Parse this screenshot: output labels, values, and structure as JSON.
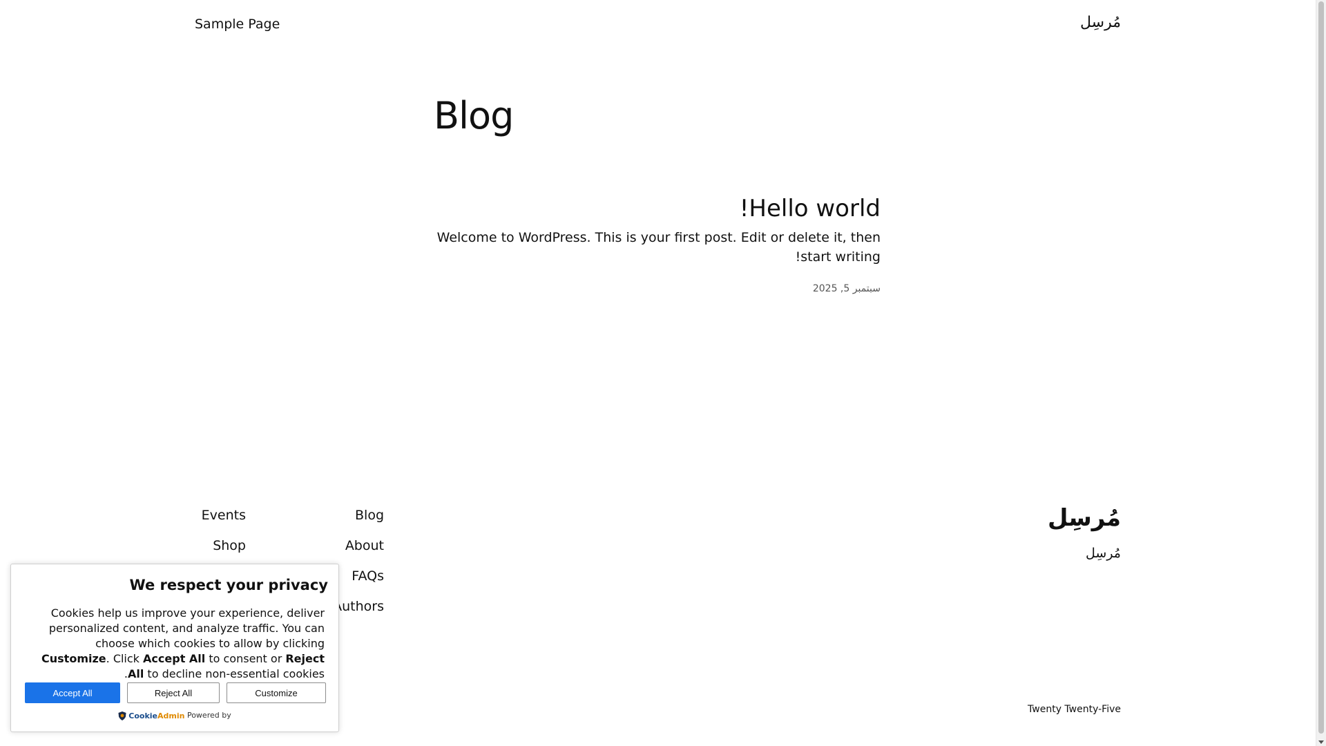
{
  "header": {
    "site_title": "مُرسِل",
    "nav_link": "Sample Page"
  },
  "main": {
    "page_title": "Blog",
    "post": {
      "title": "Hello world!",
      "excerpt": "Welcome to WordPress. This is your first post. Edit or delete it, then start writing!",
      "date": "سبتمبر 5, 2025"
    }
  },
  "footer": {
    "site_title": "مُرسِل",
    "tagline": "مُرسِل",
    "nav_col_1": [
      "Blog",
      "About",
      "FAQs",
      "Authors"
    ],
    "nav_col_2": [
      "Events",
      "Shop"
    ],
    "credit": "Twenty Twenty-Five"
  },
  "cookie_banner": {
    "title": "We respect your privacy",
    "text_1": "Cookies help us improve your experience, deliver personalized content, and analyze traffic. You can choose which cookies to allow by clicking ",
    "customize_bold": "Customize",
    "text_2": ". Click ",
    "accept_bold": "Accept All",
    "text_3": " to consent or ",
    "reject_bold": "Reject All",
    "text_4": " to decline non-essential cookies.",
    "accept_label": "Accept All",
    "reject_label": "Reject All",
    "customize_label": "Customize",
    "powered_by": "Powered by",
    "brand_part_1": "Cookie",
    "brand_part_2": "Admin",
    "accent_color": "#1a73e8"
  }
}
